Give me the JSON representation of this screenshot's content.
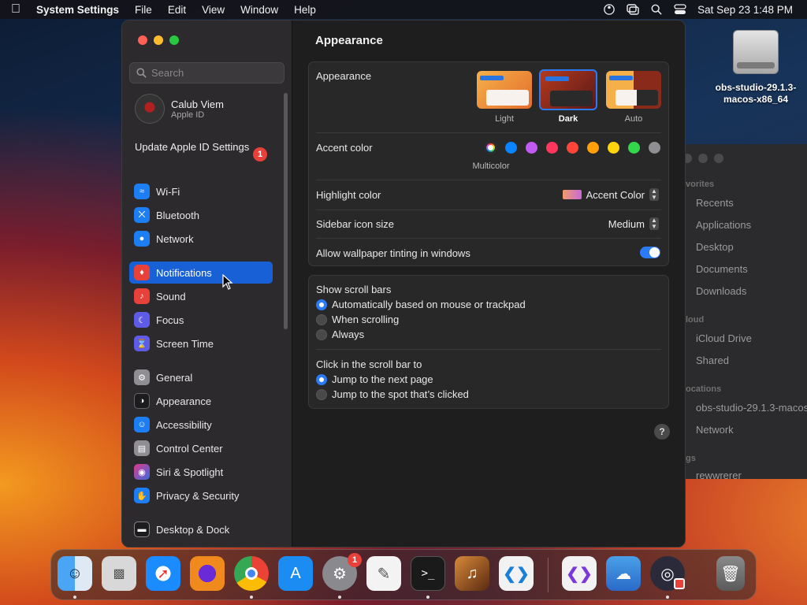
{
  "menubar": {
    "app_name": "System Settings",
    "menus": [
      "File",
      "Edit",
      "View",
      "Window",
      "Help"
    ],
    "datetime": "Sat Sep 23  1:48 PM"
  },
  "desktop": {
    "disk_label": "obs-studio-29.1.3-macos-x86_64"
  },
  "finder": {
    "sections": [
      "vorites",
      "loud",
      "ocations",
      "gs"
    ],
    "items": [
      "Recents",
      "Applications",
      "Desktop",
      "Documents",
      "Downloads",
      "iCloud Drive",
      "Shared",
      "obs-studio-29.1.3-macos",
      "Network",
      "rewwrerer"
    ]
  },
  "sidebar": {
    "search_placeholder": "Search",
    "user": {
      "name": "Calub Viem",
      "subtitle": "Apple ID"
    },
    "update": {
      "label": "Update Apple ID Settings",
      "badge": "1"
    },
    "items": [
      {
        "label": "Wi-Fi",
        "icon": "wifi-icon",
        "color": "#1c7ef2"
      },
      {
        "label": "Bluetooth",
        "icon": "bluetooth-icon",
        "color": "#1c7ef2"
      },
      {
        "label": "Network",
        "icon": "globe-icon",
        "color": "#1c7ef2"
      },
      {
        "label": "Notifications",
        "icon": "bell-icon",
        "color": "#e8413a"
      },
      {
        "label": "Sound",
        "icon": "speaker-icon",
        "color": "#e8413a"
      },
      {
        "label": "Focus",
        "icon": "moon-icon",
        "color": "#5e5ce6"
      },
      {
        "label": "Screen Time",
        "icon": "hourglass-icon",
        "color": "#5e5ce6"
      },
      {
        "label": "General",
        "icon": "gear-icon",
        "color": "#8e8e93"
      },
      {
        "label": "Appearance",
        "icon": "appearance-icon",
        "color": "#1c1c1e"
      },
      {
        "label": "Accessibility",
        "icon": "accessibility-icon",
        "color": "#1c7ef2"
      },
      {
        "label": "Control Center",
        "icon": "control-center-icon",
        "color": "#8e8e93"
      },
      {
        "label": "Siri & Spotlight",
        "icon": "siri-icon",
        "color": "#7d3cc8"
      },
      {
        "label": "Privacy & Security",
        "icon": "hand-icon",
        "color": "#1c7ef2"
      },
      {
        "label": "Desktop & Dock",
        "icon": "dock-icon",
        "color": "#1c1c1e"
      }
    ]
  },
  "content": {
    "title": "Appearance",
    "appearance": {
      "label": "Appearance",
      "options": [
        "Light",
        "Dark",
        "Auto"
      ],
      "selected": "Dark"
    },
    "accent": {
      "label": "Accent color",
      "selected_caption": "Multicolor",
      "colors": [
        "#ff3b30",
        "#0a84ff",
        "#bf5af2",
        "#ff375f",
        "#ff453a",
        "#ff9f0a",
        "#ffd60a",
        "#32d74b",
        "#8e8e93"
      ]
    },
    "highlight": {
      "label": "Highlight color",
      "value": "Accent Color"
    },
    "sidebar_icon": {
      "label": "Sidebar icon size",
      "value": "Medium"
    },
    "tinting": {
      "label": "Allow wallpaper tinting in windows",
      "on": true
    },
    "scrollbars": {
      "label": "Show scroll bars",
      "options": [
        "Automatically based on mouse or trackpad",
        "When scrolling",
        "Always"
      ],
      "selected": 0
    },
    "click_scroll": {
      "label": "Click in the scroll bar to",
      "options": [
        "Jump to the next page",
        "Jump to the spot that’s clicked"
      ],
      "selected": 0
    },
    "help": "?"
  },
  "dock": {
    "apps": [
      {
        "name": "finder-icon",
        "color": "#2a8ef0"
      },
      {
        "name": "launchpad-icon",
        "color": "#d9d9d9"
      },
      {
        "name": "safari-icon",
        "color": "#1a8cff"
      },
      {
        "name": "firefox-icon",
        "color": "#e86a1c"
      },
      {
        "name": "chrome-icon",
        "color": "#f2f2f2"
      },
      {
        "name": "app-store-icon",
        "color": "#1b8df2"
      },
      {
        "name": "system-settings-icon",
        "color": "#8a8a8e"
      },
      {
        "name": "textedit-icon",
        "color": "#f3f3f3"
      },
      {
        "name": "terminal-icon",
        "color": "#1a1a1a"
      },
      {
        "name": "garageband-icon",
        "color": "#6a3a1a"
      },
      {
        "name": "vscode-icon",
        "color": "#f2f2f2"
      },
      {
        "name": "visual-studio-icon",
        "color": "#f2f2f2"
      },
      {
        "name": "weather-icon",
        "color": "#3a8ad8"
      },
      {
        "name": "obs-icon",
        "color": "#2a2a3a"
      },
      {
        "name": "trash-icon",
        "color": "#6a6a6a"
      }
    ],
    "settings_badge": "1"
  }
}
